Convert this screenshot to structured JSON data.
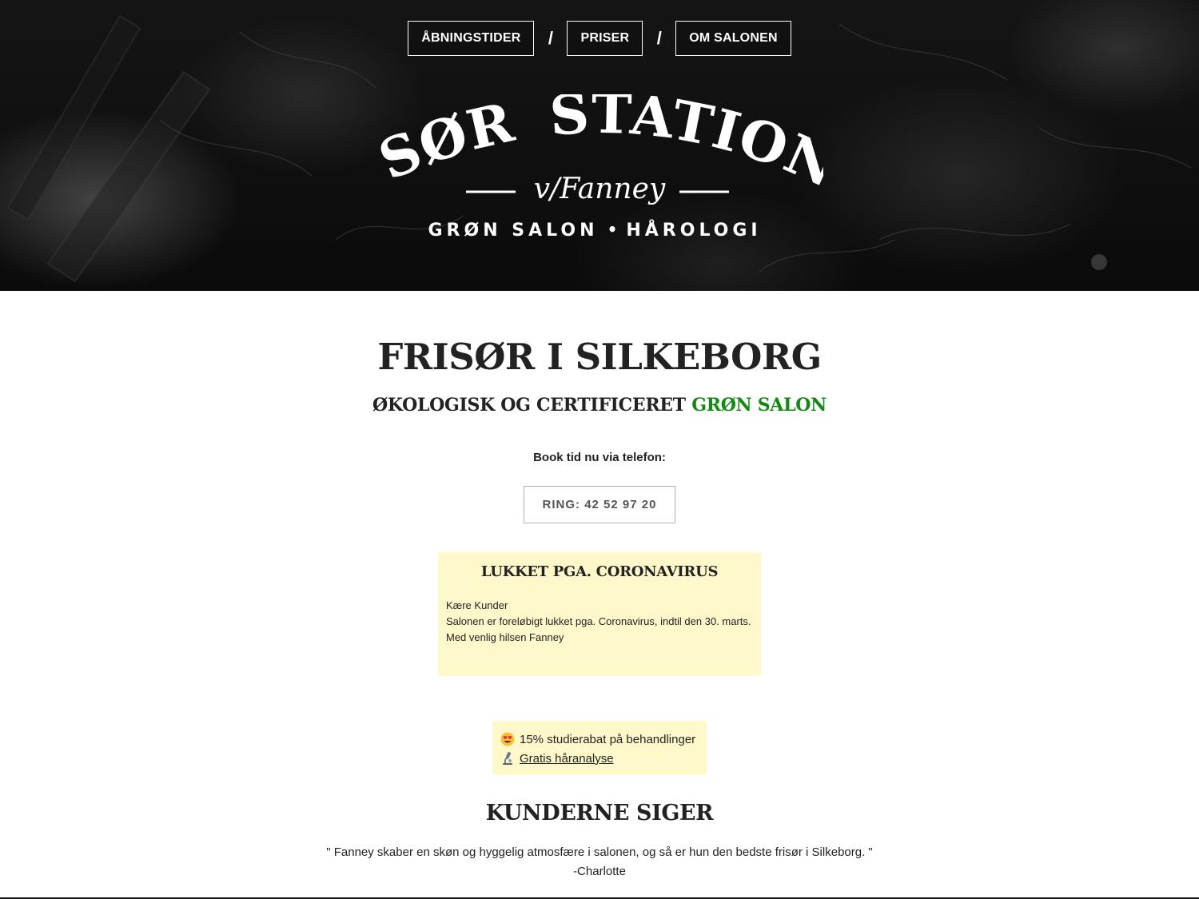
{
  "nav": {
    "items": [
      {
        "label": "ÅBNINGSTIDER"
      },
      {
        "label": "PRISER"
      },
      {
        "label": "OM SALONEN"
      }
    ],
    "separator": "/"
  },
  "logo": {
    "word1": "FRISØR",
    "word2": "STATIONEN",
    "byline": "v/Fanney",
    "tagline_left": "GRØN SALON",
    "tagline_dot": "•",
    "tagline_right": "HÅROLOGI"
  },
  "main": {
    "title": "FRISØR I SILKEBORG",
    "subtitle_prefix": "ØKOLOGISK OG CERTIFICERET",
    "subtitle_highlight": "GRØN SALON",
    "book_label": "Book tid nu via telefon:",
    "call_button": "RING: 42 52 97 20"
  },
  "notice": {
    "title": "LUKKET PGA. CORONAVIRUS",
    "lines": [
      "Kære Kunder",
      "Salonen er foreløbigt lukket pga. Coronavirus, indtil den 30. marts.",
      "Med venlig hilsen Fanney"
    ]
  },
  "promo": {
    "discount_icon": "heart-eyes-emoji-icon",
    "discount_text": "15% studierabat på behandlinger",
    "analysis_icon": "microscope-icon",
    "analysis_link": "Gratis håranalyse"
  },
  "testimonials": {
    "title": "KUNDERNE SIGER",
    "quote": "\" Fanney skaber en skøn og hyggelig atmosfære i salonen, og så er hun den bedste frisør i Silkeborg. \"",
    "author": "-Charlotte"
  },
  "colors": {
    "accent_green": "#128a12",
    "notice_bg": "#fff8cb",
    "hero_bg": "#0e0e0e"
  }
}
